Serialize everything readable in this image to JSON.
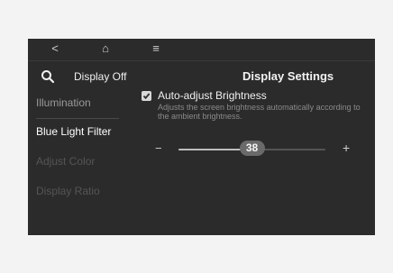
{
  "nav": {
    "back_glyph": "<",
    "home_glyph": "⌂",
    "menu_glyph": "≡"
  },
  "toolbar": {
    "search_icon": "search-icon",
    "display_off_label": "Display Off"
  },
  "page": {
    "title": "Display Settings"
  },
  "sidebar": {
    "items": [
      {
        "label": "Illumination",
        "state": "normal"
      },
      {
        "label": "Blue Light Filter",
        "state": "active"
      },
      {
        "label": "Adjust Color",
        "state": "disabled"
      },
      {
        "label": "Display Ratio",
        "state": "disabled"
      }
    ]
  },
  "auto_brightness": {
    "checked": true,
    "label": "Auto-adjust Brightness",
    "description": "Adjusts the screen brightness automatically according to the ambient brightness."
  },
  "brightness": {
    "minus_label": "−",
    "plus_label": "+",
    "value": "38",
    "level": 0.5
  },
  "colors": {
    "screen_bg": "#2b2b2b",
    "outer_bg": "#f3f3f3",
    "active_text": "#ffffff",
    "normal_text": "#9a9a9a",
    "disabled_text": "#555555"
  }
}
